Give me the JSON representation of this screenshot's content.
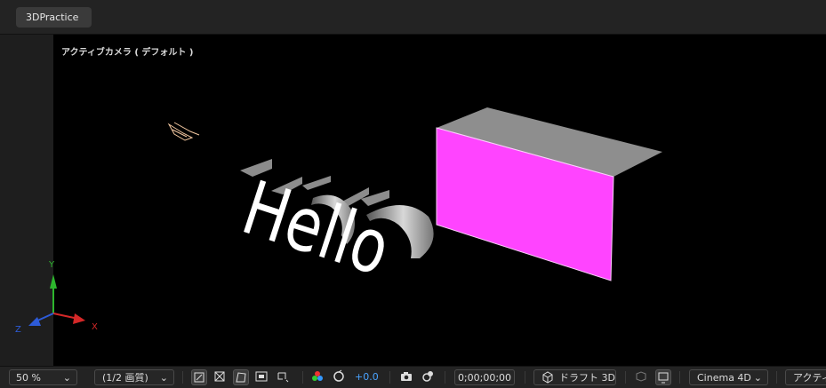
{
  "tab": {
    "label": "3DPractice"
  },
  "viewer": {
    "camera_label": "アクティブカメラ ( デフォルト )",
    "text_layer": "Hello",
    "axes": {
      "x": "X",
      "y": "Y",
      "z": "Z"
    },
    "solid_color": "#ff44ff"
  },
  "toolbar": {
    "zoom": "50 %",
    "resolution": "(1/2 画質)",
    "exposure": "+0.0",
    "timecode": "0;00;00;00",
    "draft3d": "ドラフト 3D",
    "renderer": "Cinema 4D",
    "view": "アクティブ"
  },
  "icons": {
    "transparency_grid": "transparency-grid-icon",
    "region_of_interest": "region-of-interest-icon",
    "mask_visibility": "mask-visibility-icon",
    "safe_area": "safe-area-icon",
    "guides": "guides-icon",
    "color_channels": "color-channels-icon",
    "reset_exposure": "reset-exposure-icon",
    "snapshot": "snapshot-icon",
    "show_snapshot": "show-snapshot-icon",
    "draft3d": "draft-3d-icon",
    "extended_viewer": "extended-viewer-icon",
    "preview": "preview-icon"
  }
}
